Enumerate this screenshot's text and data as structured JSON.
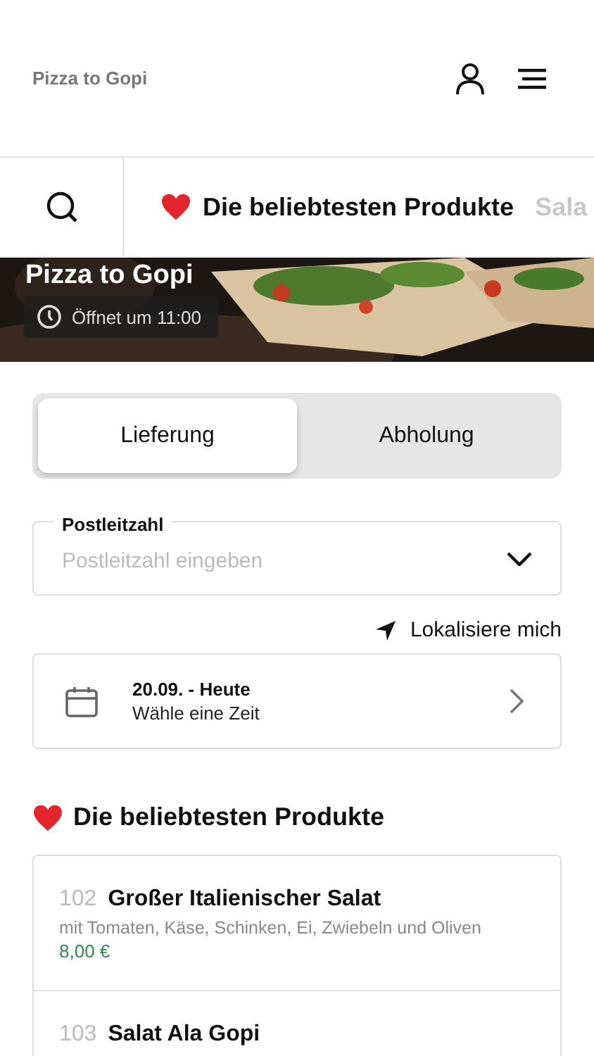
{
  "header": {
    "title": "Pizza to Gopi"
  },
  "category_bar": {
    "categories": [
      {
        "label": "Die beliebtesten Produkte",
        "selected": true,
        "kind": "favorite"
      },
      {
        "label": "Sala",
        "selected": false,
        "kind": "plain"
      }
    ]
  },
  "hero": {
    "kind": "picture",
    "title": "Pizza to Gopi",
    "opening": "Öffnet um 11:00"
  },
  "order_mode": [
    {
      "label": "Lieferung",
      "selected": true
    },
    {
      "label": "Abholung",
      "selected": false
    }
  ],
  "postcode": {
    "label": "Postleitzahl",
    "placeholder": "Postleitzahl eingeben"
  },
  "locate": {
    "label": "Lokalisiere mich"
  },
  "date": {
    "title": "20.09. - Heute",
    "subtitle": "Wähle eine Zeit"
  },
  "section": {
    "title": "Die beliebtesten Produkte"
  },
  "products": [
    {
      "number": "102",
      "name": "Großer Italienischer Salat",
      "description": "mit Tomaten, Käse, Schinken, Ei, Zwiebeln und Oliven",
      "price": "8,00 €"
    },
    {
      "number": "103",
      "name": "Salat Ala Gopi"
    }
  ]
}
